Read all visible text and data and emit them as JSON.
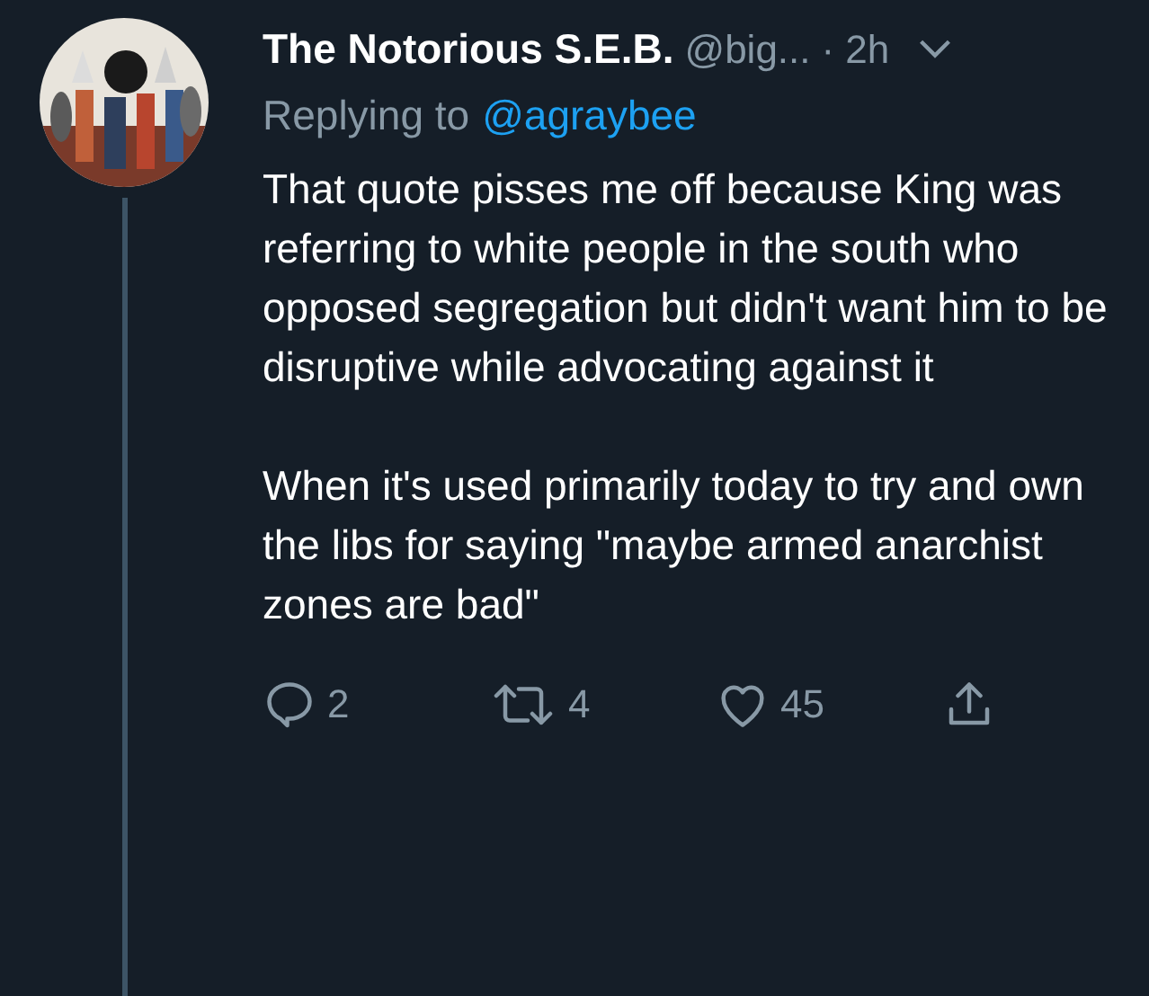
{
  "tweet": {
    "display_name": "The Notorious S.E.B.",
    "handle": "@big...",
    "separator": "·",
    "time": "2h",
    "reply_prefix": "Replying to",
    "reply_to": "@agraybee",
    "paragraphs": [
      "That quote pisses me off because King was referring to white people in the south who opposed segregation but didn't want him to be disruptive while advocating against it",
      "When it's used primarily today to try and own the libs for saying \"maybe armed anarchist zones are bad\""
    ],
    "actions": [
      {
        "kind": "reply",
        "count": "2"
      },
      {
        "kind": "retweet",
        "count": "4"
      },
      {
        "kind": "like",
        "count": "45"
      },
      {
        "kind": "share"
      }
    ]
  }
}
